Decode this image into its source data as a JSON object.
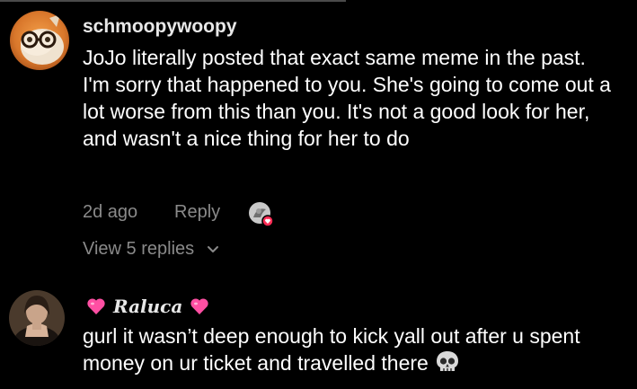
{
  "comments": [
    {
      "username": "schmoopywoopy",
      "text_lines": [
        "JoJo literally posted that exact same meme in the past.",
        "I'm sorry that happened to you. She's going to come out a lot worse from this than you. It's not a good look for her, and wasn't a nice thing for her to do"
      ],
      "time": "2d ago",
      "reply_label": "Reply",
      "view_replies": "View 5 replies"
    },
    {
      "username": "Raluca",
      "username_decoration": "pink-heart-icon",
      "text": "gurl it wasn’t deep enough to kick yall out after u spent money on ur ticket and travelled there",
      "trailing_emoji": "skull-icon"
    }
  ],
  "colors": {
    "background": "#000000",
    "text": "#ffffff",
    "muted": "#8a8a8a",
    "heart": "#ff4fa3",
    "like_badge": "#ff2d55"
  }
}
